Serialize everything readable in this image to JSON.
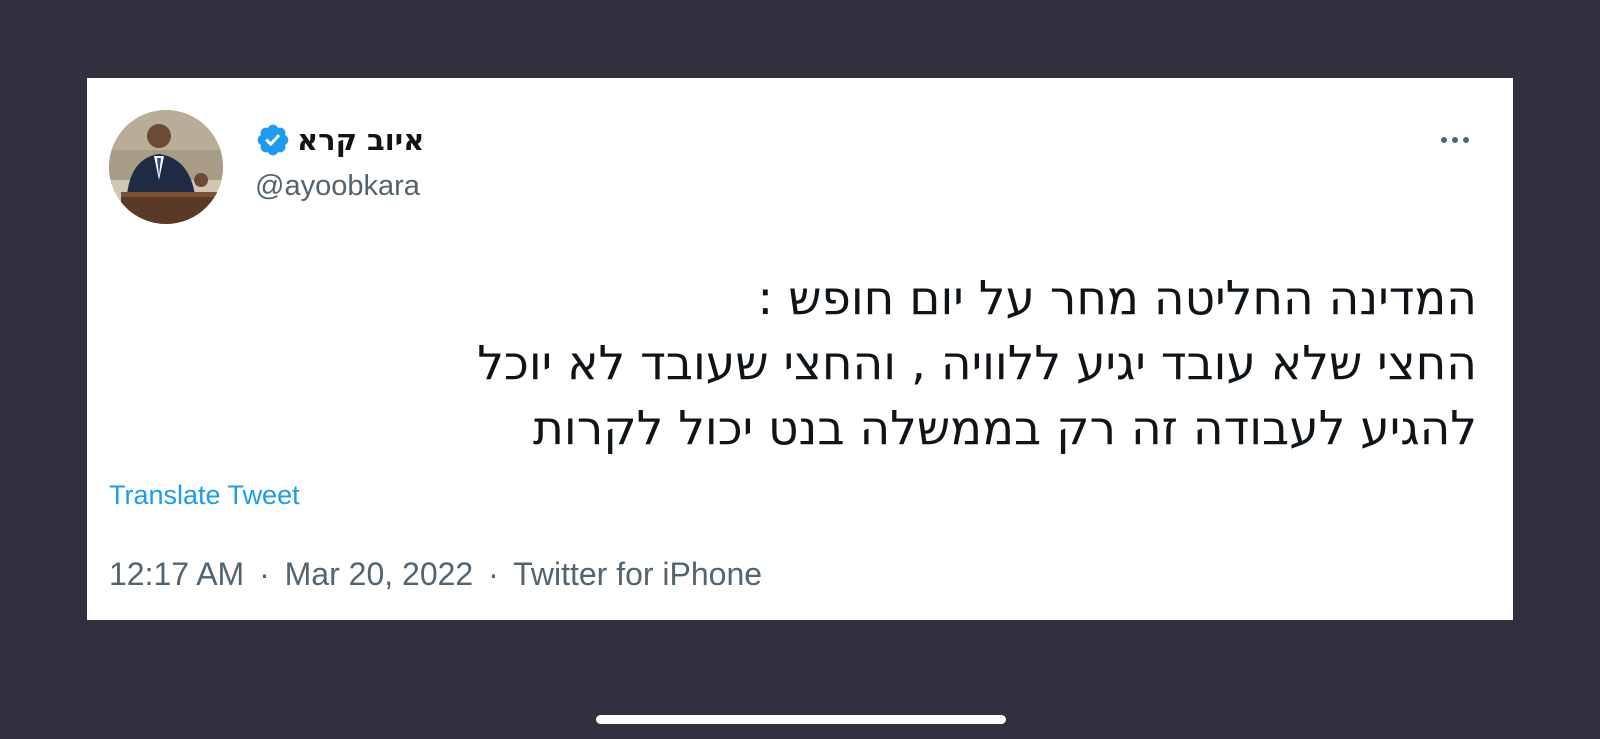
{
  "tweet": {
    "author": {
      "display_name": "איוב קרא",
      "handle": "@ayoobkara",
      "verified": true,
      "avatar_icon": "profile-photo-speaker-at-podium"
    },
    "text_lines": [
      "המדינה החליטה מחר על יום חופש :",
      "החצי שלא עובד יגיע ללוויה , והחצי שעובד לא יוכל",
      "להגיע לעבודה זה רק בממשלה בנט יכול לקרות"
    ],
    "translate_label": "Translate Tweet",
    "time": "12:17 AM",
    "date": "Mar 20, 2022",
    "source": "Twitter for iPhone",
    "separator": "·",
    "more_icon": "more-horizontal-icon"
  },
  "colors": {
    "background": "#30303f",
    "card": "#ffffff",
    "text": "#0f1419",
    "secondary": "#536471",
    "link": "#1d9bf0",
    "verified": "#1d9bf0"
  }
}
